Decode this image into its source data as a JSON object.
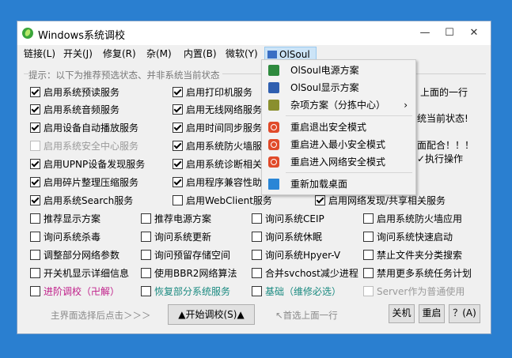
{
  "window": {
    "title": "Windows系统调校",
    "minimize": "—",
    "maximize": "☐",
    "close": "✕"
  },
  "menubar": [
    "链接(L)",
    "开关(J)",
    "修复(R)",
    "杂(M)",
    "内置(B)",
    "微软(Y)",
    "OlSoul"
  ],
  "hint": "提示：以下为推荐预选状态、并非系统当前状态",
  "col1": [
    {
      "label": "启用系统预读服务",
      "checked": true,
      "disabled": false
    },
    {
      "label": "启用系统音频服务",
      "checked": true,
      "disabled": false
    },
    {
      "label": "启用设备自动播放服务",
      "checked": true,
      "disabled": false
    },
    {
      "label": "启用系统安全中心服务",
      "checked": false,
      "disabled": true
    },
    {
      "label": "启用UPNP设备发现服务",
      "checked": true,
      "disabled": false
    },
    {
      "label": "启用碎片整理压缩服务",
      "checked": true,
      "disabled": false
    },
    {
      "label": "启用系统Search服务",
      "checked": true,
      "disabled": false
    }
  ],
  "col2": [
    {
      "label": "启用打印机服务",
      "checked": true
    },
    {
      "label": "启用无线网络服务",
      "checked": true
    },
    {
      "label": "启用时间同步服务",
      "checked": true
    },
    {
      "label": "启用系统防火墙服",
      "checked": true
    },
    {
      "label": "启用系统诊断相关",
      "checked": true
    },
    {
      "label": "启用程序兼容性助",
      "checked": true
    },
    {
      "label": "启用WebClient服务",
      "checked": false
    }
  ],
  "right_texts": [
    "上面的一行",
    "统当前状态!",
    "面配合！！！",
    "✓执行操作"
  ],
  "network_item": {
    "label": "启用网络发现/共享相关服务",
    "checked": true
  },
  "grid": [
    [
      "推荐显示方案",
      "推荐电源方案",
      "询问系统CEIP",
      "启用系统防火墙应用"
    ],
    [
      "询问系统杀毒",
      "询问系统更新",
      "询问系统休眠",
      "询问系统快速启动"
    ],
    [
      "调整部分网络参数",
      "询问预留存储空间",
      "询问系统Hpyer-V",
      "禁止文件夹分类搜索"
    ],
    [
      "开关机显示详细信息",
      "使用BBR2网络算法",
      "合并svchost减少进程",
      "禁用更多系统任务计划"
    ]
  ],
  "bottom_row": [
    {
      "label": "进阶调校（卍解）",
      "color": "#c0208a"
    },
    {
      "label": "恢复部分系统服务",
      "color": "#1a8a80"
    },
    {
      "label": "基础（维修必选）",
      "color": "#1a8a80"
    },
    {
      "label": "Server作为普通使用",
      "color": "#9a9a9a"
    }
  ],
  "footer": {
    "left_hint": "主界面选择后点击＞＞＞",
    "start": "▲开始调校(S)▲",
    "mid_hint": "↖首选上面一行",
    "about": "关机",
    "restart": "重启",
    "help": "？(A)"
  },
  "dropdown": [
    {
      "label": "OlSoul电源方案",
      "icon": "power-plan-icon"
    },
    {
      "label": "OlSoul显示方案",
      "icon": "display-plan-icon"
    },
    {
      "label": "杂项方案（分拣中心）",
      "icon": "misc-plan-icon",
      "submenu": "›"
    },
    {
      "label": "重启退出安全模式",
      "icon": "restart-icon"
    },
    {
      "label": "重启进入最小安全模式",
      "icon": "restart-icon"
    },
    {
      "label": "重启进入网络安全模式",
      "icon": "restart-icon"
    },
    {
      "label": "重新加载桌面",
      "icon": "desktop-icon"
    }
  ]
}
